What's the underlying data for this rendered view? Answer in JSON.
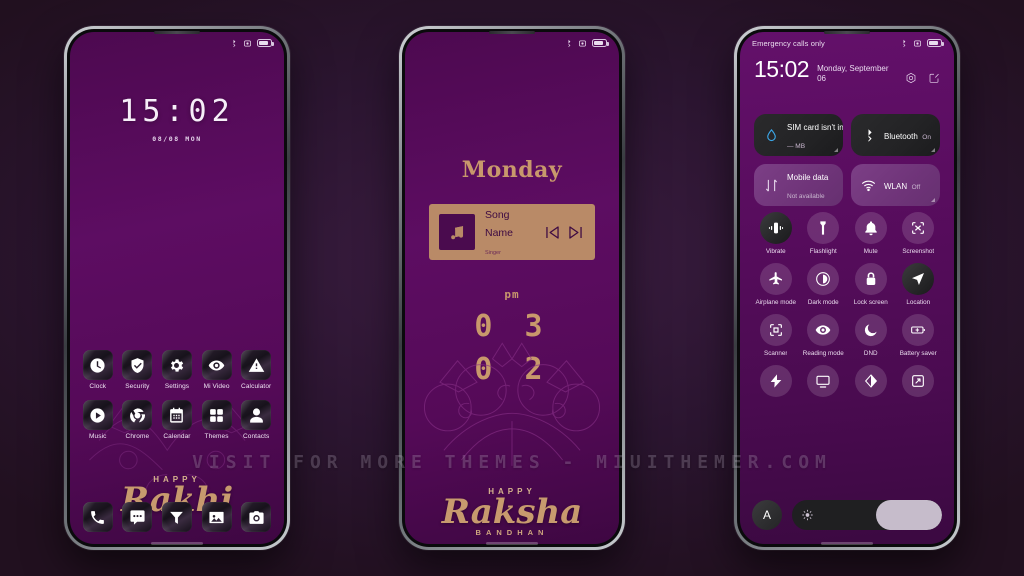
{
  "watermark": "VISIT FOR MORE THEMES - MIUITHEMER.COM",
  "theme": {
    "wallpaper_purple": "#5a0a5f",
    "accent_gold": "#c8986c",
    "background": "#2d1832",
    "toggle_on": "#7c3f86",
    "toggle_off": "#232325"
  },
  "phone1": {
    "status": {
      "carrier": "",
      "icons": [
        "bluetooth-icon",
        "alarm-icon",
        "battery-icon"
      ]
    },
    "clock": "15:02",
    "date": "08/08 MON",
    "greeting": {
      "top": "HAPPY",
      "main": "Rakhi",
      "sub": ""
    },
    "apps_row1": [
      {
        "label": "Clock",
        "icon": "clock-icon"
      },
      {
        "label": "Security",
        "icon": "shield-check-icon"
      },
      {
        "label": "Settings",
        "icon": "gear-icon"
      },
      {
        "label": "Mi Video",
        "icon": "eye-icon"
      },
      {
        "label": "Calculator",
        "icon": "warning-triangle-icon"
      }
    ],
    "apps_row2": [
      {
        "label": "Music",
        "icon": "play-circle-icon"
      },
      {
        "label": "Chrome",
        "icon": "chrome-icon"
      },
      {
        "label": "Calendar",
        "icon": "calendar-icon"
      },
      {
        "label": "Themes",
        "icon": "grid-icon"
      },
      {
        "label": "Contacts",
        "icon": "person-icon"
      }
    ],
    "dock": [
      {
        "label": "Phone",
        "icon": "phone-icon"
      },
      {
        "label": "Messages",
        "icon": "chat-bubble-icon"
      },
      {
        "label": "Browser",
        "icon": "funnel-icon"
      },
      {
        "label": "Gallery",
        "icon": "image-icon"
      },
      {
        "label": "Camera",
        "icon": "camera-icon"
      }
    ]
  },
  "phone2": {
    "status": {
      "icons": [
        "bluetooth-icon",
        "alarm-icon",
        "battery-icon"
      ]
    },
    "day": "Monday",
    "music": {
      "title": "Song Name",
      "singer": "Singer",
      "art_icon": "music-note-icon",
      "prev_icon": "skip-previous-icon",
      "next_icon": "skip-next-icon"
    },
    "meridiem": "pm",
    "hours": "0 3",
    "minutes": "0 2",
    "greeting": {
      "top": "HAPPY",
      "main": "Raksha",
      "sub": "BANDHAN"
    }
  },
  "phone3": {
    "status": {
      "carrier": "Emergency calls only",
      "icons": [
        "bluetooth-icon",
        "alarm-icon",
        "battery-icon"
      ]
    },
    "time": "15:02",
    "date": "Monday, September 06",
    "actions": [
      {
        "name": "settings-icon"
      },
      {
        "name": "edit-icon"
      }
    ],
    "cards": [
      {
        "title": "SIM card isn't installed",
        "subtitle": "— MB",
        "icon": "data-drop-icon",
        "state": "off"
      },
      {
        "title": "Bluetooth",
        "subtitle": "On",
        "icon": "bluetooth-icon",
        "state": "off"
      },
      {
        "title": "Mobile data",
        "subtitle": "Not available",
        "icon": "data-arrows-icon",
        "state": "on"
      },
      {
        "title": "WLAN",
        "subtitle": "Off",
        "icon": "wifi-icon",
        "state": "on"
      }
    ],
    "tiles": [
      {
        "label": "Vibrate",
        "icon": "vibrate-icon",
        "active": true
      },
      {
        "label": "Flashlight",
        "icon": "flashlight-icon",
        "active": false
      },
      {
        "label": "Mute",
        "icon": "bell-icon",
        "active": false
      },
      {
        "label": "Screenshot",
        "icon": "screenshot-icon",
        "active": false
      },
      {
        "label": "Airplane mode",
        "icon": "airplane-icon",
        "active": false
      },
      {
        "label": "Dark mode",
        "icon": "contrast-circle-icon",
        "active": false
      },
      {
        "label": "Lock screen",
        "icon": "lock-icon",
        "active": false
      },
      {
        "label": "Location",
        "icon": "location-arrow-icon",
        "active": true
      },
      {
        "label": "Scanner",
        "icon": "scan-frame-icon",
        "active": false
      },
      {
        "label": "Reading mode",
        "icon": "eye-icon",
        "active": false
      },
      {
        "label": "DND",
        "icon": "moon-icon",
        "active": false
      },
      {
        "label": "Battery saver",
        "icon": "battery-plus-icon",
        "active": false
      },
      {
        "label": "",
        "icon": "lightning-icon",
        "active": false
      },
      {
        "label": "",
        "icon": "cast-icon",
        "active": false
      },
      {
        "label": "",
        "icon": "color-contrast-icon",
        "active": false
      },
      {
        "label": "",
        "icon": "rotate-screen-icon",
        "active": false
      }
    ],
    "brightness": {
      "auto_label": "A",
      "icon": "sun-icon",
      "level": 44
    }
  }
}
